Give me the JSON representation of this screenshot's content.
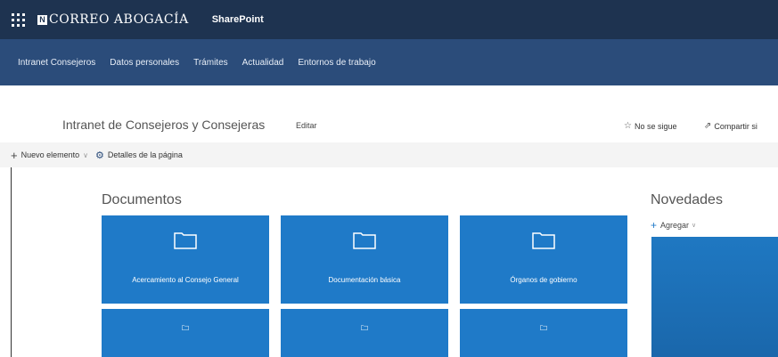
{
  "suite_bar": {
    "brand_mark": "N",
    "brand_text": "CORREO ABOGACÍA",
    "app_name": "SharePoint"
  },
  "site_nav": {
    "items": [
      "Intranet Consejeros",
      "Datos personales",
      "Trámites",
      "Actualidad",
      "Entornos de trabajo"
    ]
  },
  "header": {
    "site_title": "Intranet de Consejeros y Consejeras",
    "edit_label": "Editar",
    "follow_label": "No se sigue",
    "share_label": "Compartir si"
  },
  "command_bar": {
    "new_item_label": "Nuevo elemento",
    "page_details_label": "Detalles de la página"
  },
  "documents": {
    "title": "Documentos",
    "tiles": [
      {
        "label": "Acercamiento al Consejo General"
      },
      {
        "label": "Documentación básica"
      },
      {
        "label": "Órganos de gobierno"
      },
      {
        "label": ""
      },
      {
        "label": ""
      },
      {
        "label": ""
      }
    ]
  },
  "news": {
    "title": "Novedades",
    "add_label": "Agregar"
  },
  "colors": {
    "suite_bar": "#1e3350",
    "site_nav": "#2b4c7a",
    "tile_blue": "#1f7ac8"
  },
  "icons": {
    "app_launcher": "waffle-icon",
    "folder": "folder-icon",
    "star": "star-icon",
    "share": "share-icon",
    "gear": "gear-icon",
    "plus": "plus-icon"
  }
}
